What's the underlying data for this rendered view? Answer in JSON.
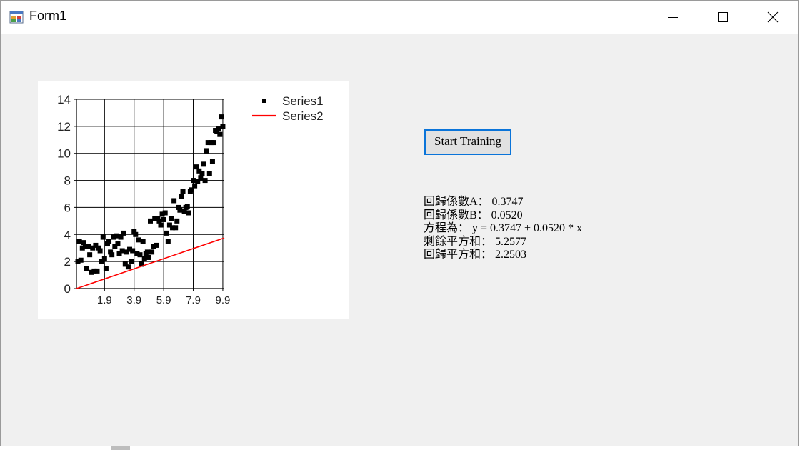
{
  "window": {
    "title": "Form1"
  },
  "controls": {
    "start_button_label": "Start Training"
  },
  "results": {
    "line1": "回歸係數A： 0.3747",
    "line2": "回歸係數B： 0.0520",
    "line3": "方程為： y = 0.3747 + 0.0520 * x",
    "line4": "剩餘平方和： 5.2577",
    "line5": "回歸平方和： 2.2503"
  },
  "chart_data": {
    "type": "scatter",
    "xlim": [
      0,
      10
    ],
    "ylim": [
      0,
      14
    ],
    "y_ticks": [
      0,
      2,
      4,
      6,
      8,
      10,
      12,
      14
    ],
    "x_tick_values": [
      1.9,
      3.9,
      5.9,
      7.9,
      9.9
    ],
    "x_tick_labels": [
      "1.9",
      "3.9",
      "5.9",
      "7.9",
      "9.9"
    ],
    "grid": true,
    "legend_position": "top-right",
    "series": [
      {
        "name": "Series1",
        "type": "scatter",
        "color": "#000000",
        "points": [
          [
            0.1,
            2.0
          ],
          [
            0.2,
            3.5
          ],
          [
            0.3,
            2.1
          ],
          [
            0.4,
            3.0
          ],
          [
            0.5,
            3.4
          ],
          [
            0.6,
            3.1
          ],
          [
            0.7,
            1.5
          ],
          [
            0.8,
            3.1
          ],
          [
            0.9,
            2.5
          ],
          [
            1.0,
            1.2
          ],
          [
            1.1,
            3.0
          ],
          [
            1.2,
            1.3
          ],
          [
            1.3,
            3.2
          ],
          [
            1.4,
            1.3
          ],
          [
            1.5,
            3.0
          ],
          [
            1.6,
            2.8
          ],
          [
            1.7,
            2.0
          ],
          [
            1.8,
            3.8
          ],
          [
            1.9,
            2.2
          ],
          [
            2.0,
            1.5
          ],
          [
            2.1,
            3.3
          ],
          [
            2.2,
            3.5
          ],
          [
            2.3,
            2.7
          ],
          [
            2.4,
            2.5
          ],
          [
            2.5,
            3.8
          ],
          [
            2.6,
            3.1
          ],
          [
            2.7,
            3.9
          ],
          [
            2.8,
            3.3
          ],
          [
            2.9,
            2.6
          ],
          [
            3.0,
            3.8
          ],
          [
            3.1,
            2.8
          ],
          [
            3.2,
            4.1
          ],
          [
            3.3,
            1.8
          ],
          [
            3.4,
            2.7
          ],
          [
            3.5,
            1.6
          ],
          [
            3.6,
            2.9
          ],
          [
            3.7,
            2.0
          ],
          [
            3.8,
            2.8
          ],
          [
            3.9,
            4.2
          ],
          [
            4.0,
            4.0
          ],
          [
            4.1,
            2.6
          ],
          [
            4.2,
            3.6
          ],
          [
            4.3,
            2.5
          ],
          [
            4.4,
            1.8
          ],
          [
            4.5,
            3.5
          ],
          [
            4.6,
            2.2
          ],
          [
            4.7,
            2.6
          ],
          [
            4.8,
            2.7
          ],
          [
            4.9,
            2.3
          ],
          [
            5.0,
            5.0
          ],
          [
            5.1,
            2.7
          ],
          [
            5.2,
            3.1
          ],
          [
            5.3,
            5.2
          ],
          [
            5.4,
            3.2
          ],
          [
            5.5,
            5.2
          ],
          [
            5.6,
            5.0
          ],
          [
            5.7,
            4.7
          ],
          [
            5.8,
            5.5
          ],
          [
            5.9,
            5.1
          ],
          [
            6.0,
            5.6
          ],
          [
            6.1,
            4.1
          ],
          [
            6.2,
            3.5
          ],
          [
            6.3,
            4.7
          ],
          [
            6.4,
            5.2
          ],
          [
            6.5,
            4.5
          ],
          [
            6.6,
            6.5
          ],
          [
            6.7,
            4.5
          ],
          [
            6.8,
            5.0
          ],
          [
            6.9,
            6.0
          ],
          [
            7.0,
            5.8
          ],
          [
            7.1,
            6.8
          ],
          [
            7.2,
            7.2
          ],
          [
            7.3,
            5.7
          ],
          [
            7.4,
            6.0
          ],
          [
            7.5,
            6.1
          ],
          [
            7.6,
            5.6
          ],
          [
            7.7,
            7.2
          ],
          [
            7.8,
            7.3
          ],
          [
            7.9,
            8.0
          ],
          [
            8.0,
            7.6
          ],
          [
            8.1,
            9.0
          ],
          [
            8.2,
            7.9
          ],
          [
            8.3,
            8.7
          ],
          [
            8.4,
            8.2
          ],
          [
            8.5,
            8.5
          ],
          [
            8.6,
            9.2
          ],
          [
            8.7,
            8.0
          ],
          [
            8.8,
            10.2
          ],
          [
            8.9,
            10.8
          ],
          [
            9.0,
            8.5
          ],
          [
            9.1,
            10.8
          ],
          [
            9.2,
            9.4
          ],
          [
            9.3,
            10.8
          ],
          [
            9.4,
            11.7
          ],
          [
            9.5,
            11.6
          ],
          [
            9.6,
            11.8
          ],
          [
            9.7,
            11.4
          ],
          [
            9.8,
            12.7
          ],
          [
            9.9,
            12.0
          ]
        ]
      },
      {
        "name": "Series2",
        "type": "line",
        "color": "#ff0000",
        "points": [
          [
            0.0,
            0.0
          ],
          [
            10.0,
            3.747
          ]
        ]
      }
    ]
  }
}
